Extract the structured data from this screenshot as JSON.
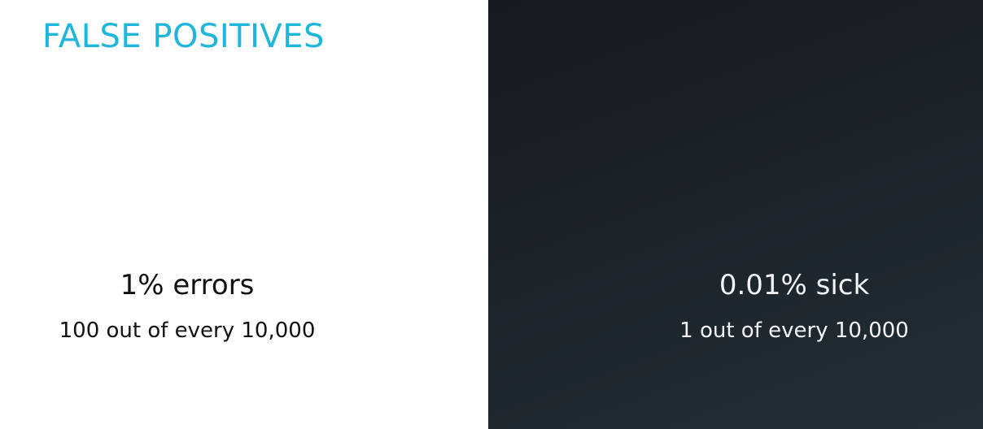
{
  "slide": {
    "title": "FALSE POSITIVES",
    "left": {
      "headline": "1% errors",
      "detail": "100 out of every 10,000"
    },
    "right": {
      "headline": "0.01% sick",
      "detail": "1 out of every 10,000"
    }
  },
  "colors": {
    "title": "#1eb6dc",
    "left_background": "#ffffff",
    "right_background": "#1c2329"
  }
}
